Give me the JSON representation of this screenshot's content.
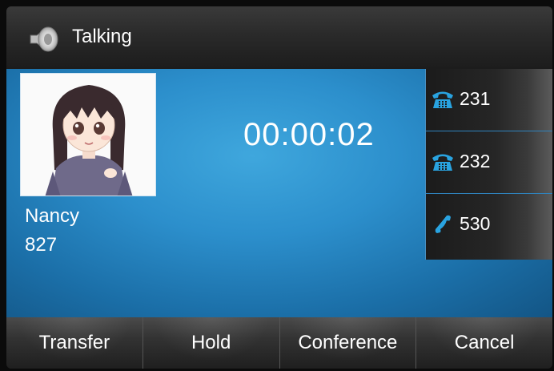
{
  "header": {
    "title": "Talking",
    "icon": "speaker-icon"
  },
  "call": {
    "contact_name": "Nancy",
    "contact_number": "827",
    "duration": "00:00:02",
    "avatar": "avatar-illustration"
  },
  "lines": [
    {
      "label": "231",
      "icon": "desk-phone-icon"
    },
    {
      "label": "232",
      "icon": "desk-phone-icon"
    },
    {
      "label": "530",
      "icon": "handset-icon"
    }
  ],
  "softkeys": [
    "Transfer",
    "Hold",
    "Conference",
    "Cancel"
  ],
  "colors": {
    "accent_blue": "#2c8fcc",
    "line_icon_blue": "#29a3e0"
  }
}
